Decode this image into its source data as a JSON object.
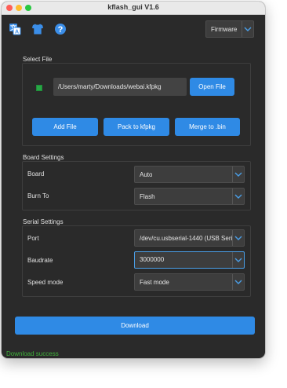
{
  "window": {
    "title": "kflash_gui V1.6"
  },
  "toolbar": {
    "icons": [
      "language-icon",
      "shirt-icon",
      "help-icon"
    ],
    "firmware_select": "Firmware"
  },
  "select_file": {
    "title": "Select File",
    "path": "/Users/marty/Downloads/webai.kfpkg",
    "open_label": "Open File",
    "add_label": "Add File",
    "pack_label": "Pack to kfpkg",
    "merge_label": "Merge to .bin"
  },
  "board_settings": {
    "title": "Board Settings",
    "board_label": "Board",
    "board_value": "Auto",
    "burn_label": "Burn To",
    "burn_value": "Flash"
  },
  "serial_settings": {
    "title": "Serial Settings",
    "port_label": "Port",
    "port_value": "/dev/cu.usbserial-1440 (USB Seria",
    "baud_label": "Baudrate",
    "baud_value": "3000000",
    "speed_label": "Speed mode",
    "speed_value": "Fast mode"
  },
  "actions": {
    "download_label": "Download"
  },
  "status": {
    "text": "Download success"
  },
  "colors": {
    "accent": "#2f8ae5",
    "background": "#2a2a2a",
    "success": "#3fb13a",
    "checkbox": "#28a745"
  }
}
